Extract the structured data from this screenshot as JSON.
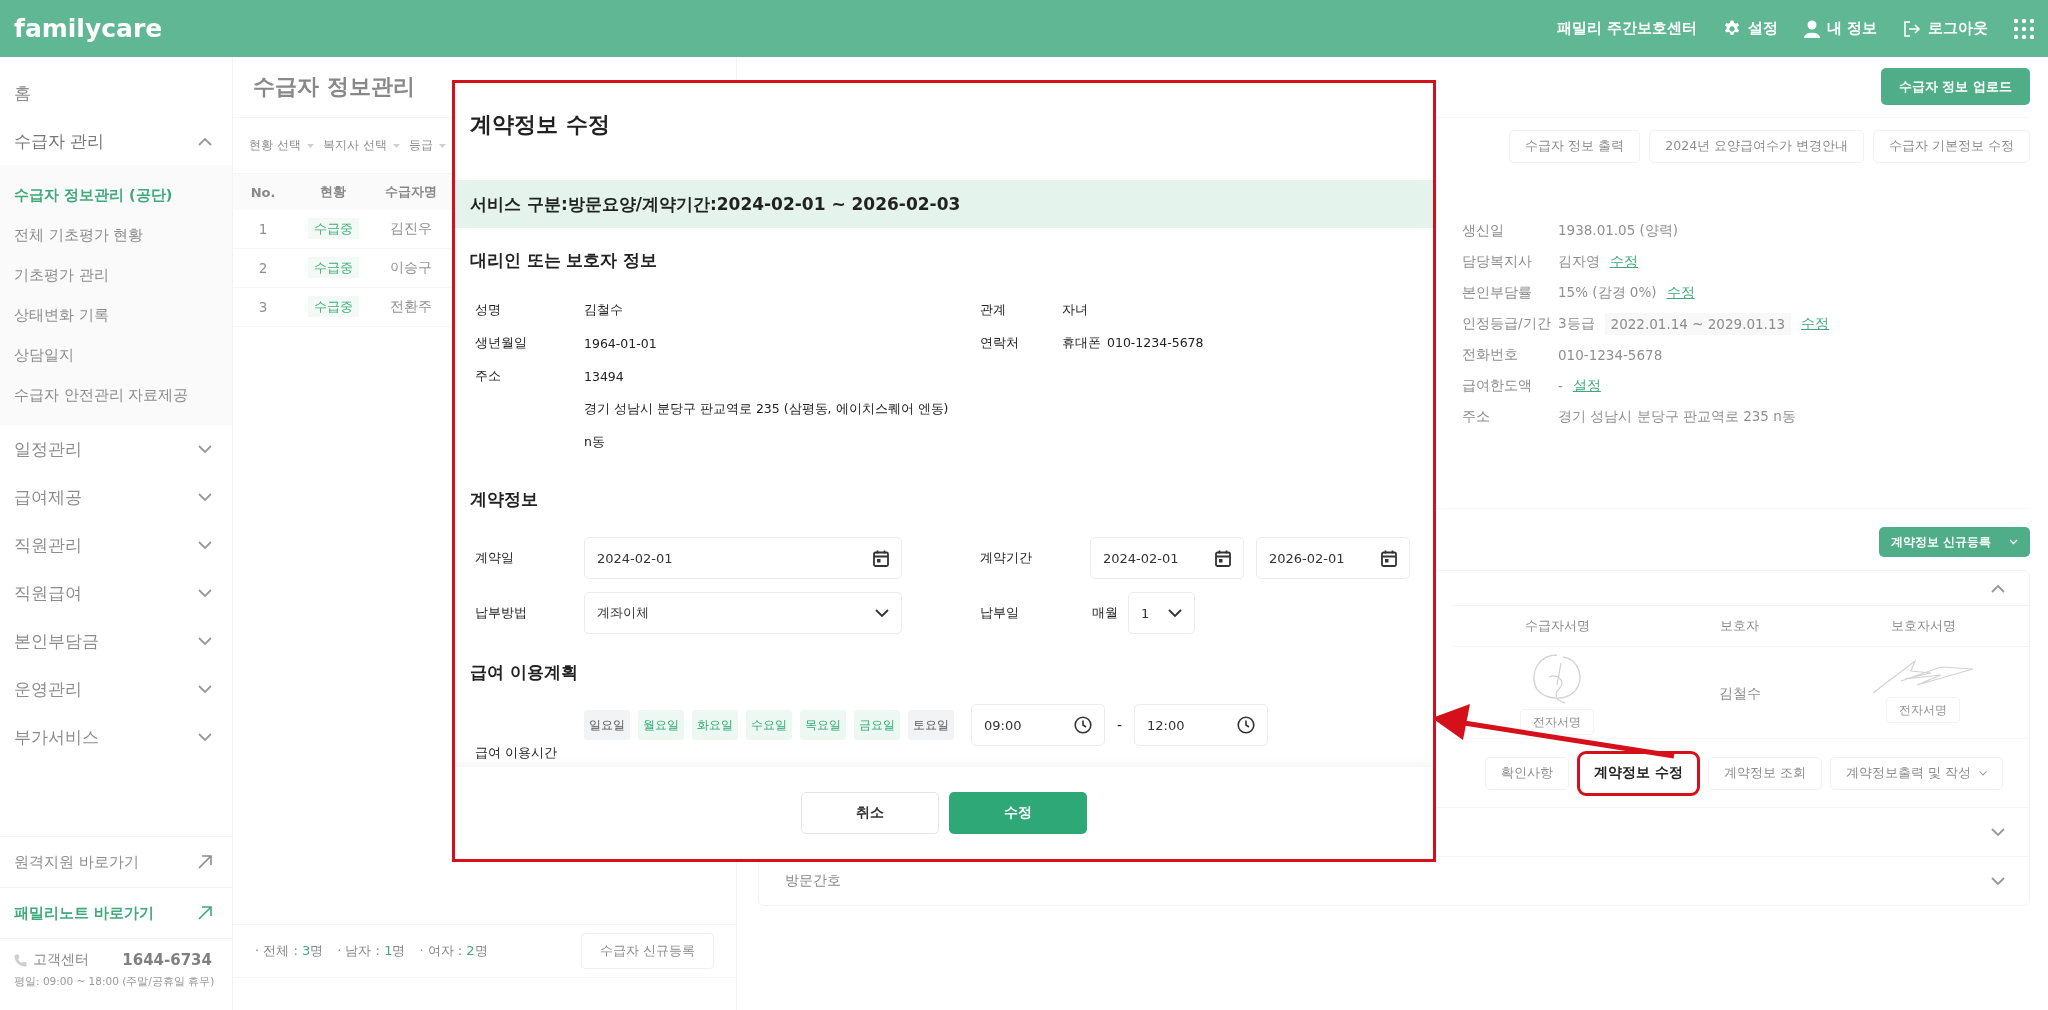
{
  "header": {
    "logo": "familycare",
    "center_name": "패밀리 주간보호센터",
    "links": [
      {
        "kind": "settings",
        "label": "설정"
      },
      {
        "kind": "profile",
        "label": "내 정보"
      },
      {
        "kind": "logout",
        "label": "로그아웃"
      }
    ]
  },
  "sidebar": {
    "items": [
      {
        "kind": "link",
        "label": "홈"
      },
      {
        "kind": "group",
        "label": "수급자 관리",
        "expanded": true,
        "children": [
          {
            "label": "수급자 정보관리 (공단)",
            "selected": true
          },
          {
            "label": "전체 기초평가 현황",
            "selected": false
          },
          {
            "label": "기초평가 관리",
            "selected": false
          },
          {
            "label": "상태변화 기록",
            "selected": false
          },
          {
            "label": "상담일지",
            "selected": false
          },
          {
            "label": "수급자 안전관리 자료제공",
            "selected": false
          }
        ]
      },
      {
        "kind": "group",
        "label": "일정관리",
        "expanded": false
      },
      {
        "kind": "group",
        "label": "급여제공",
        "expanded": false
      },
      {
        "kind": "group",
        "label": "직원관리",
        "expanded": false
      },
      {
        "kind": "group",
        "label": "직원급여",
        "expanded": false
      },
      {
        "kind": "group",
        "label": "본인부담금",
        "expanded": false
      },
      {
        "kind": "group",
        "label": "운영관리",
        "expanded": false
      },
      {
        "kind": "group",
        "label": "부가서비스",
        "expanded": false
      }
    ],
    "links": [
      {
        "kind": "plain",
        "label": "원격지원 바로가기"
      },
      {
        "kind": "accent",
        "label": "패밀리노트 바로가기"
      }
    ],
    "support": {
      "label": "고객센터",
      "phone": "1644-6734",
      "hours": "평일: 09:00 ~ 18:00 (주말/공휴일 휴무)"
    }
  },
  "recipient_list": {
    "title": "수급자 정보관리",
    "filters": [
      "현황 선택",
      "복지사 선택",
      "등급"
    ],
    "table": {
      "columns": [
        "No.",
        "현황",
        "수급자명"
      ],
      "rows": [
        {
          "no": "1",
          "status": "수급중",
          "name": "김진우"
        },
        {
          "no": "2",
          "status": "수급중",
          "name": "이승구"
        },
        {
          "no": "3",
          "status": "수급중",
          "name": "전환주"
        }
      ]
    },
    "summary": [
      {
        "label": "· 전체 :",
        "count": "3",
        "unit": "명"
      },
      {
        "label": "· 남자 :",
        "count": "1",
        "unit": "명"
      },
      {
        "label": "· 여자 :",
        "count": "2",
        "unit": "명"
      }
    ],
    "register_button": "수급자 신규등록"
  },
  "recipient_detail": {
    "upload_button": "수급자 정보 업로드",
    "actions": [
      "수급자 정보 출력",
      "2024년 요양급여수가 변경안내",
      "수급자 기본정보 수정"
    ],
    "info": [
      {
        "label": "생신일",
        "value": "1938.01.05 (양력)"
      },
      {
        "label": "담당복지사",
        "value": "김자영",
        "link": "수정"
      },
      {
        "label": "본인부담률",
        "value": "15% (감경 0%)",
        "link": "수정"
      },
      {
        "label": "인정등급/기간",
        "value": "3등급",
        "period": "2022.01.14 ~ 2029.01.13",
        "link": "수정"
      },
      {
        "label": "전화번호",
        "value": "010-1234-5678"
      },
      {
        "label": "급여한도액",
        "value": "-",
        "link": "설정"
      },
      {
        "label": "주소",
        "value": "경기 성남시 분당구 판교역로 235 n동"
      }
    ],
    "contract": {
      "new_button": "계약정보 신규등록",
      "expanded": true,
      "columns": [
        "수급자서명",
        "보호자",
        "보호자서명"
      ],
      "guardian": "김철수",
      "sign_buttons": [
        "전자서명",
        "전자서명"
      ],
      "actions": [
        {
          "kind": "button",
          "label": "확인사항",
          "highlighted": false
        },
        {
          "kind": "button",
          "label": "계약정보 수정",
          "highlighted": true
        },
        {
          "kind": "button",
          "label": "계약정보 조회",
          "highlighted": false
        },
        {
          "kind": "dropdown",
          "label": "계약정보출력 및 작성",
          "highlighted": false
        }
      ],
      "sections": [
        {
          "expanded": false
        },
        {
          "label": "방문간호",
          "expanded": false
        }
      ]
    }
  },
  "dialog": {
    "title": "계약정보 수정",
    "banner": "서비스 구분:방문요양/계약기간:2024-02-01 ~ 2026-02-03",
    "guardian": {
      "title": "대리인 또는 보호자 정보",
      "rows": [
        {
          "label": "성명",
          "value": "김철수",
          "side_label": "관계",
          "side_value": "자녀"
        },
        {
          "label": "생년월일",
          "value": "1964-01-01",
          "side_label": "연락처",
          "side_prefix": "휴대폰",
          "side_value": "010-1234-5678"
        },
        {
          "label": "주소",
          "value": "13494"
        },
        {
          "value": "경기 성남시 분당구 판교역로 235 (삼평동, 에이치스퀘어 엔동)"
        },
        {
          "value": "n동"
        }
      ]
    },
    "contract": {
      "title": "계약정보",
      "contract_date": {
        "label": "계약일",
        "value": "2024-02-01"
      },
      "period": {
        "label": "계약기간",
        "start": "2024-02-01",
        "end": "2026-02-01"
      },
      "payment_method": {
        "label": "납부방법",
        "value": "계좌이체"
      },
      "payment_day": {
        "label": "납부일",
        "prefix": "매월",
        "value": "1"
      }
    },
    "plan": {
      "title": "급여 이용계획",
      "label": "급여 이용시간",
      "days": [
        {
          "label": "일요일",
          "selected": false
        },
        {
          "label": "월요일",
          "selected": true
        },
        {
          "label": "화요일",
          "selected": true
        },
        {
          "label": "수요일",
          "selected": true
        },
        {
          "label": "목요일",
          "selected": true
        },
        {
          "label": "금요일",
          "selected": true
        },
        {
          "label": "토요일",
          "selected": false
        }
      ],
      "start": "09:00",
      "separator": "-",
      "end": "12:00"
    },
    "buttons": {
      "cancel": "취소",
      "submit": "수정"
    }
  }
}
